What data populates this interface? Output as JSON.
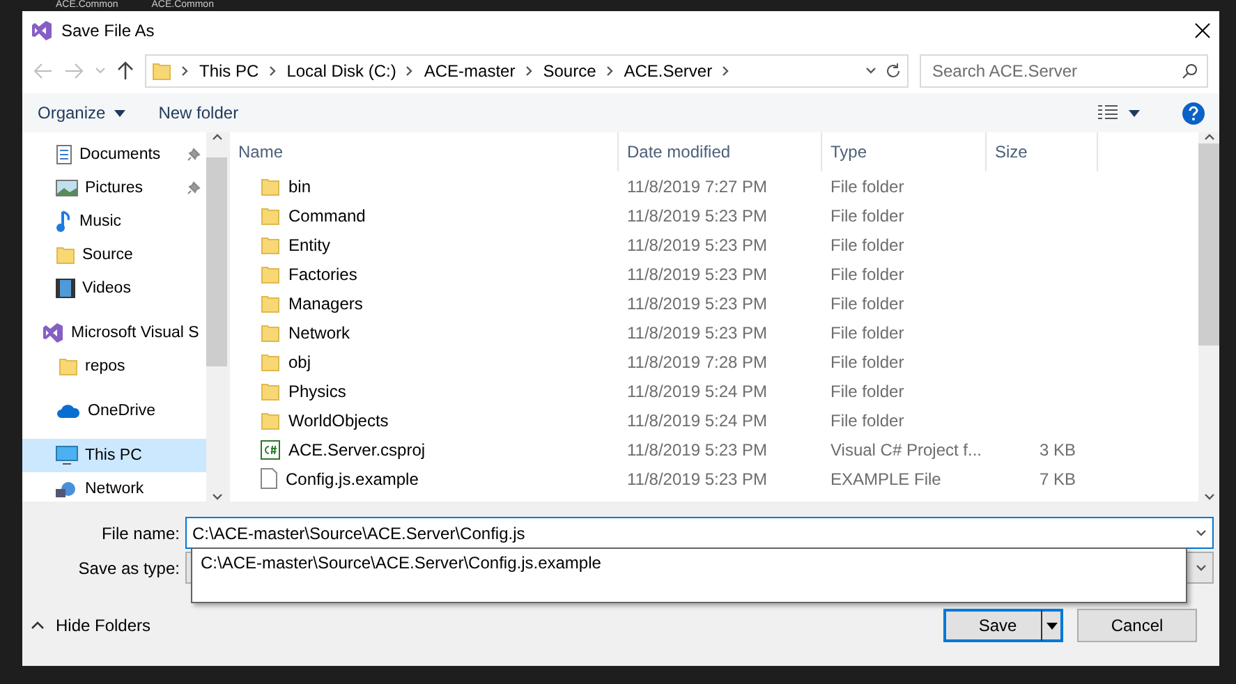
{
  "background_app": {
    "tabs": [
      "ACE.Common",
      "ACE.Common"
    ]
  },
  "window": {
    "title": "Save File As"
  },
  "address_bar": {
    "path": [
      "This PC",
      "Local Disk (C:)",
      "ACE-master",
      "Source",
      "ACE.Server"
    ]
  },
  "search": {
    "placeholder": "Search ACE.Server"
  },
  "toolbar": {
    "organize": "Organize",
    "new_folder": "New folder"
  },
  "sidebar": {
    "sections": [
      [
        {
          "label": "Documents",
          "kind": "documents",
          "pinned": true,
          "selected": false
        },
        {
          "label": "Pictures",
          "kind": "pictures",
          "pinned": true,
          "selected": false
        },
        {
          "label": "Music",
          "kind": "music",
          "pinned": false,
          "selected": false
        },
        {
          "label": "Source",
          "kind": "folder",
          "pinned": false,
          "selected": false
        },
        {
          "label": "Videos",
          "kind": "videos",
          "pinned": false,
          "selected": false
        }
      ],
      [
        {
          "label": "Microsoft Visual S",
          "kind": "vs",
          "pinned": false,
          "selected": false,
          "children": [
            {
              "label": "repos",
              "kind": "folder",
              "pinned": false,
              "selected": false
            }
          ]
        }
      ],
      [
        {
          "label": "OneDrive",
          "kind": "cloud",
          "pinned": false,
          "selected": false
        }
      ],
      [
        {
          "label": "This PC",
          "kind": "pc",
          "pinned": false,
          "selected": true
        },
        {
          "label": "Network",
          "kind": "network",
          "pinned": false,
          "selected": false
        }
      ]
    ]
  },
  "table": {
    "columns": [
      "Name",
      "Date modified",
      "Type",
      "Size"
    ],
    "rows": [
      {
        "kind": "folder",
        "name": "bin",
        "date": "11/8/2019 7:27 PM",
        "type": "File folder"
      },
      {
        "kind": "folder",
        "name": "Command",
        "date": "11/8/2019 5:23 PM",
        "type": "File folder"
      },
      {
        "kind": "folder",
        "name": "Entity",
        "date": "11/8/2019 5:23 PM",
        "type": "File folder"
      },
      {
        "kind": "folder",
        "name": "Factories",
        "date": "11/8/2019 5:23 PM",
        "type": "File folder"
      },
      {
        "kind": "folder",
        "name": "Managers",
        "date": "11/8/2019 5:23 PM",
        "type": "File folder"
      },
      {
        "kind": "folder",
        "name": "Network",
        "date": "11/8/2019 5:23 PM",
        "type": "File folder"
      },
      {
        "kind": "folder",
        "name": "obj",
        "date": "11/8/2019 7:28 PM",
        "type": "File folder"
      },
      {
        "kind": "folder",
        "name": "Physics",
        "date": "11/8/2019 5:24 PM",
        "type": "File folder"
      },
      {
        "kind": "folder",
        "name": "WorldObjects",
        "date": "11/8/2019 5:24 PM",
        "type": "File folder"
      },
      {
        "kind": "csproj",
        "name": "ACE.Server.csproj",
        "date": "11/8/2019 5:23 PM",
        "type": "Visual C# Project f...",
        "size": "3 KB"
      },
      {
        "kind": "file",
        "name": "Config.js.example",
        "date": "11/8/2019 5:23 PM",
        "type": "EXAMPLE File",
        "size": "7 KB"
      }
    ]
  },
  "file_name": {
    "label": "File name:",
    "value": "C:\\ACE-master\\Source\\ACE.Server\\Config.js"
  },
  "save_as_type": {
    "label": "Save as type:"
  },
  "autocomplete": [
    "C:\\ACE-master\\Source\\ACE.Server\\Config.js.example"
  ],
  "hide_folders": "Hide Folders",
  "buttons": {
    "save": "Save",
    "cancel": "Cancel"
  }
}
